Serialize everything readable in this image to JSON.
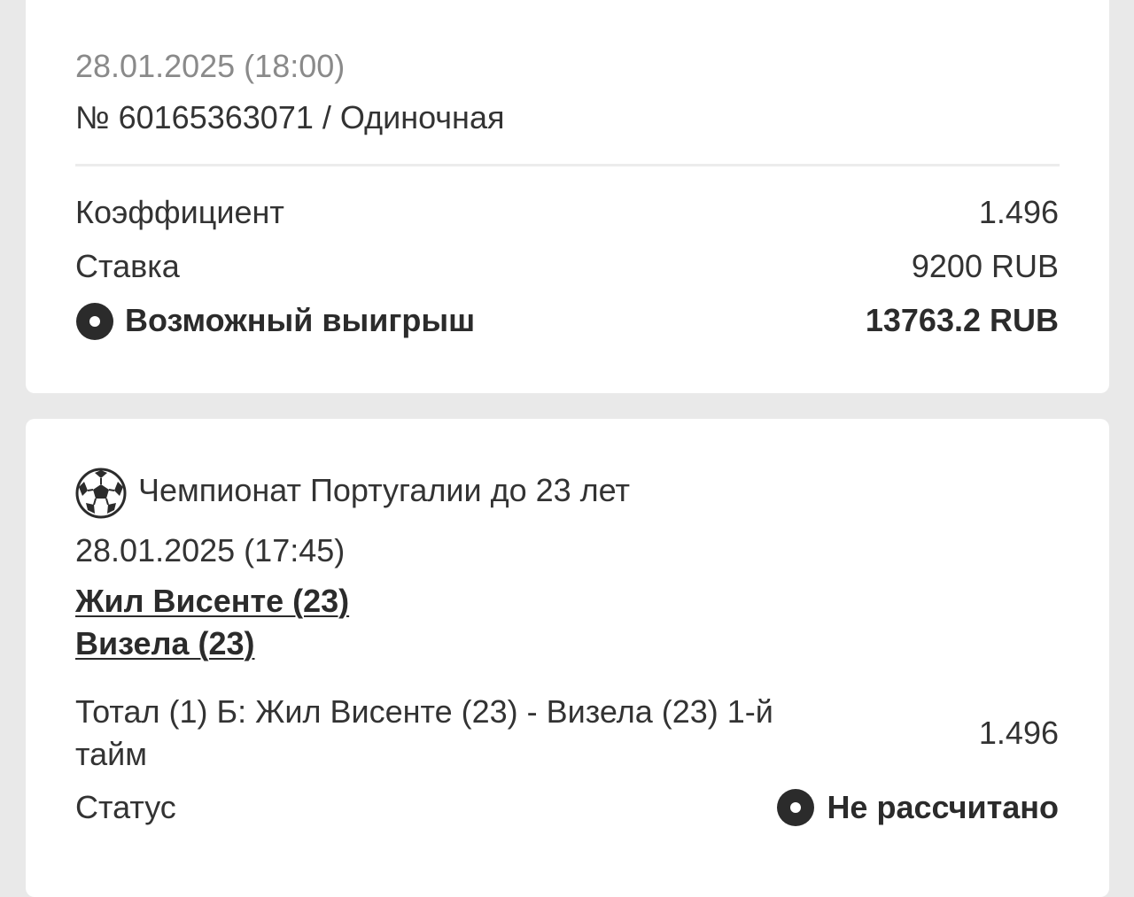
{
  "bet_summary": {
    "datetime": "28.01.2025 (18:00)",
    "bet_id_line": "№ 60165363071 / Одиночная",
    "coefficient_label": "Коэффициент",
    "coefficient_value": "1.496",
    "stake_label": "Ставка",
    "stake_value": "9200 RUB",
    "possible_win_label": "Возможный выигрыш",
    "possible_win_value": "13763.2 RUB"
  },
  "event": {
    "sport_icon": "soccer-ball-icon",
    "league": "Чемпионат Португалии до 23 лет",
    "datetime": "28.01.2025 (17:45)",
    "team1": "Жил Висенте (23)",
    "team2": "Визела (23)",
    "market_line1": "Тотал (1) Б: Жил Висенте (23) - Визела (23) 1-й",
    "market_line2": "тайм",
    "market_coef": "1.496",
    "status_label": "Статус",
    "status_value": "Не рассчитано"
  },
  "colors": {
    "background": "#e9e9e9",
    "card": "#ffffff",
    "text": "#333333",
    "muted": "#8a8a8a",
    "icon": "#2b2b2b"
  }
}
